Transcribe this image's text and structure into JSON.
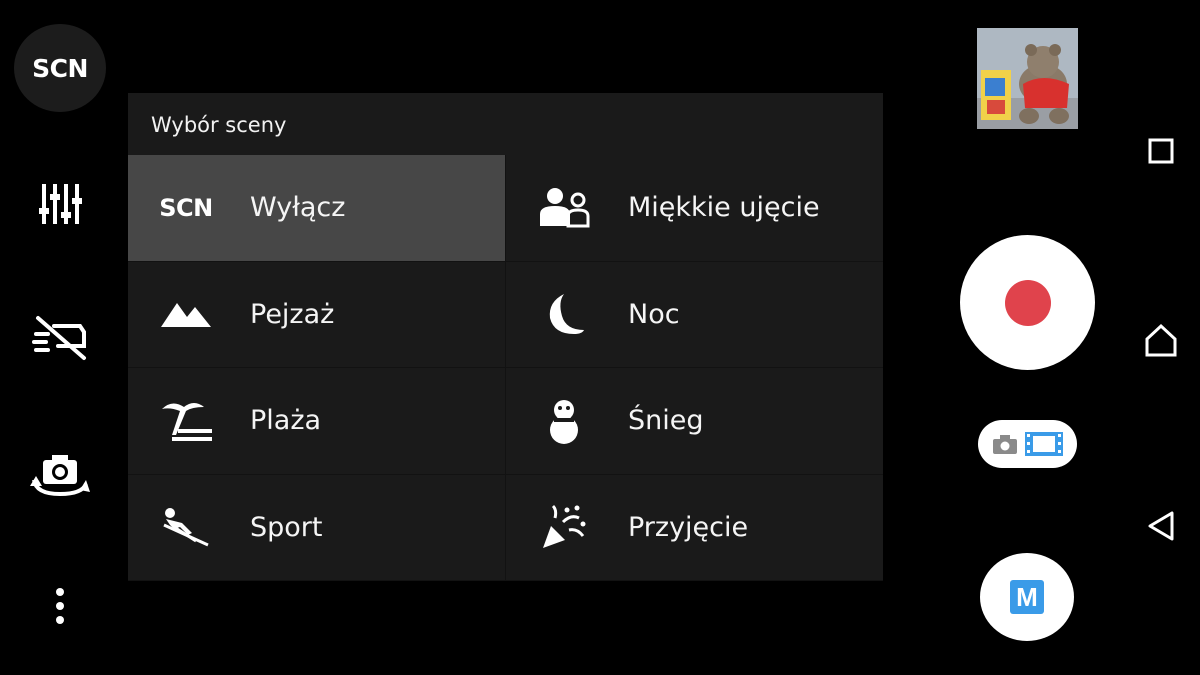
{
  "left_controls": {
    "scene_badge": "SCN"
  },
  "scene_panel": {
    "title": "Wybór sceny",
    "items": [
      {
        "label": "Wyłącz",
        "icon": "scn-text-icon",
        "icon_text": "SCN",
        "selected": true
      },
      {
        "label": "Miękkie ujęcie",
        "icon": "soft-snap-people-icon"
      },
      {
        "label": "Pejzaż",
        "icon": "landscape-mountains-icon"
      },
      {
        "label": "Noc",
        "icon": "night-moon-icon"
      },
      {
        "label": "Plaża",
        "icon": "beach-palm-icon"
      },
      {
        "label": "Śnieg",
        "icon": "snowman-icon"
      },
      {
        "label": "Sport",
        "icon": "sport-skier-icon"
      },
      {
        "label": "Przyjęcie",
        "icon": "party-popper-icon"
      }
    ]
  },
  "right_controls": {
    "manual_label": "M",
    "colors": {
      "shutter_dot": "#e0434c",
      "accent_blue": "#3a9be8",
      "selected_row": "#474747",
      "panel_bg": "#1a1a1a"
    }
  }
}
